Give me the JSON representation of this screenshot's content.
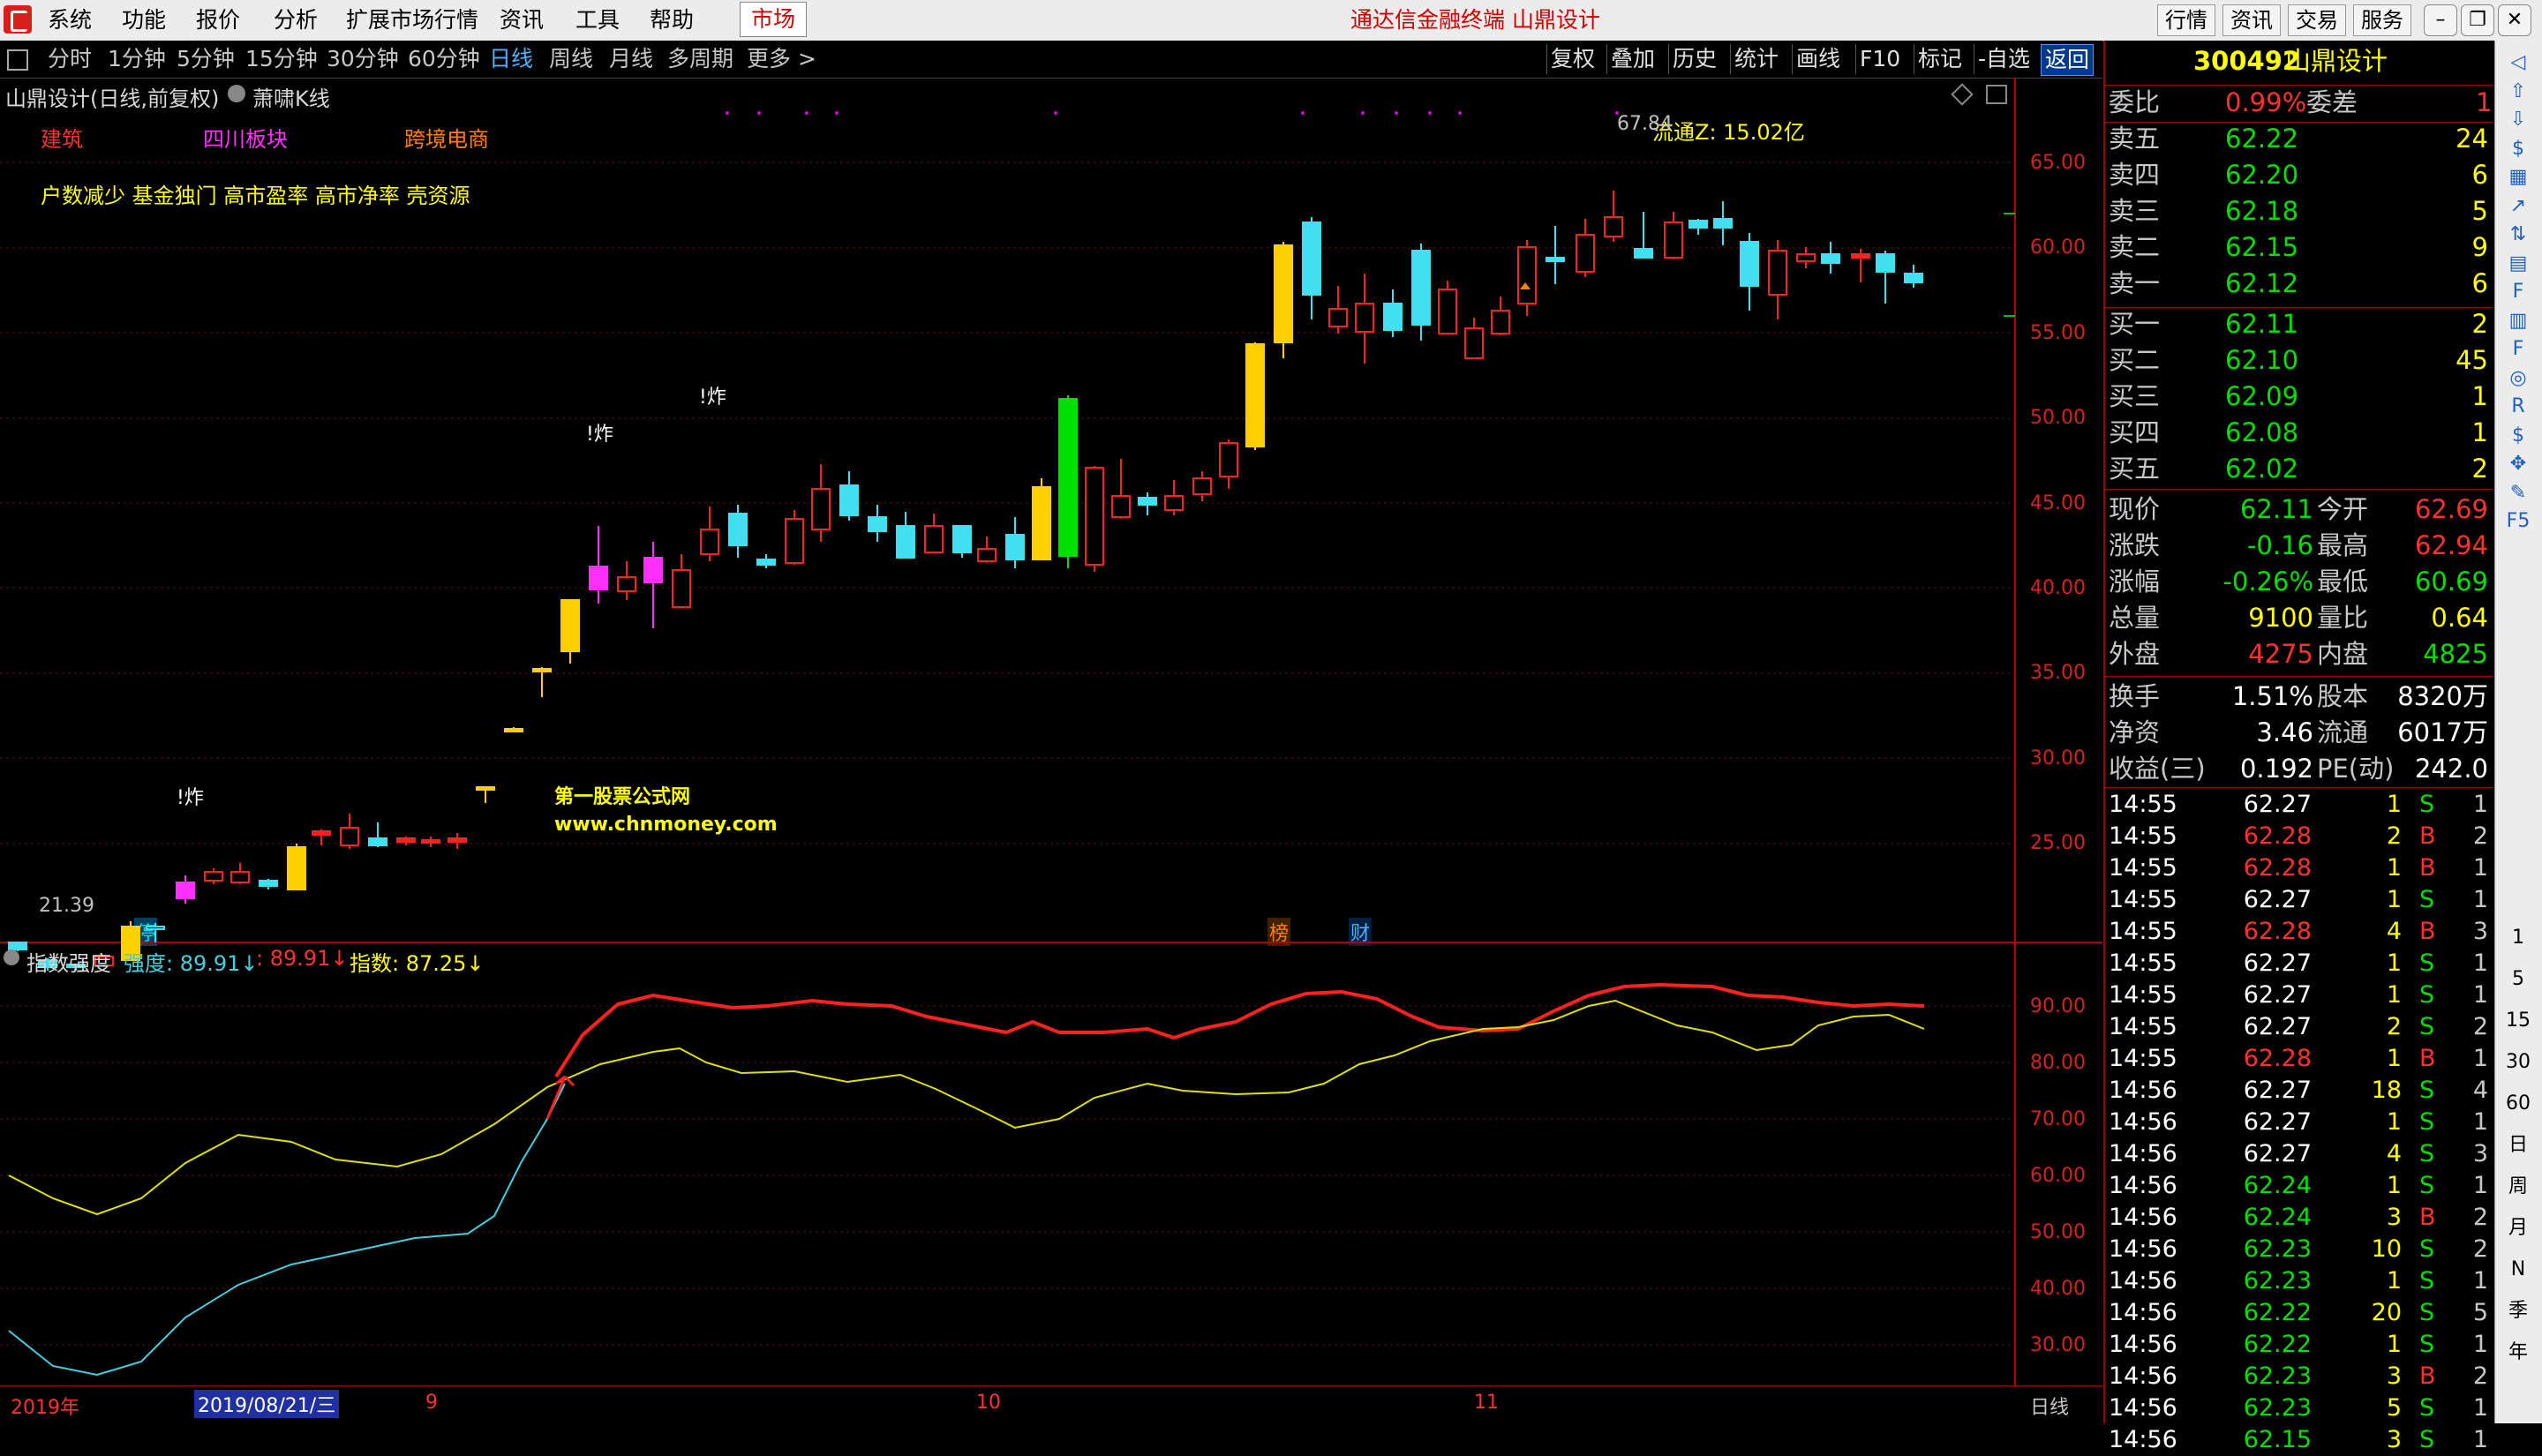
{
  "menu": {
    "items": [
      "系统",
      "功能",
      "报价",
      "分析",
      "扩展市场行情",
      "资讯",
      "工具",
      "帮助"
    ],
    "active": "市场",
    "title": "通达信金融终端  山鼎设计",
    "right_buttons": [
      "行情",
      "资讯",
      "交易",
      "服务"
    ]
  },
  "periods": [
    "分时",
    "1分钟",
    "5分钟",
    "15分钟",
    "30分钟",
    "60分钟",
    "日线",
    "周线",
    "月线",
    "多周期",
    "更多 >"
  ],
  "period_selected": "日线",
  "tools": [
    "复权",
    "叠加",
    "历史",
    "统计",
    "画线",
    "F10",
    "标记",
    "-自选",
    "返回"
  ],
  "chart": {
    "header": "山鼎设计(日线,前复权)",
    "indicator": "萧啸K线",
    "tags": [
      "建筑",
      "四川板块",
      "跨境电商"
    ],
    "features": "户数减少  基金独门  高市盈率  高市净率  壳资源",
    "watermark_name": "第一股票公式网",
    "watermark_url": "www.chnmoney.com",
    "flow_label": "流通Z: 15.02亿",
    "peak_label": "67.84",
    "low_label": "21.39",
    "zha_label": "!炸",
    "ting": "停",
    "bang": "榜",
    "cai": "财",
    "yaxis": [
      "65.00",
      "60.00",
      "55.00",
      "50.00",
      "45.00",
      "40.00",
      "35.00",
      "30.00",
      "25.00"
    ]
  },
  "indicator_pane": {
    "name": "指数强度",
    "strength_label": "强度: 89.91↓",
    "mid_value": ": 89.91↓",
    "index_label": "指数: 87.25↓",
    "yaxis": [
      "90.00",
      "80.00",
      "70.00",
      "60.00",
      "50.00",
      "40.00",
      "30.00"
    ]
  },
  "timeline": {
    "year": "2019年",
    "cursor_date": "2019/08/21/三",
    "months": [
      "9",
      "10",
      "11"
    ],
    "mode": "日线"
  },
  "stock": {
    "code": "300492",
    "name": "山鼎设计"
  },
  "quote": {
    "weibi": {
      "label": "委比",
      "value": "0.99%",
      "label2": "委差",
      "value2": "1"
    },
    "sells": [
      {
        "label": "卖五",
        "price": "62.22",
        "vol": "24"
      },
      {
        "label": "卖四",
        "price": "62.20",
        "vol": "6"
      },
      {
        "label": "卖三",
        "price": "62.18",
        "vol": "5"
      },
      {
        "label": "卖二",
        "price": "62.15",
        "vol": "9"
      },
      {
        "label": "卖一",
        "price": "62.12",
        "vol": "6"
      }
    ],
    "buys": [
      {
        "label": "买一",
        "price": "62.11",
        "vol": "2"
      },
      {
        "label": "买二",
        "price": "62.10",
        "vol": "45"
      },
      {
        "label": "买三",
        "price": "62.09",
        "vol": "1"
      },
      {
        "label": "买四",
        "price": "62.08",
        "vol": "1"
      },
      {
        "label": "买五",
        "price": "62.02",
        "vol": "2"
      }
    ],
    "stats": [
      {
        "l1": "现价",
        "v1": "62.11",
        "l2": "今开",
        "v2": "62.69"
      },
      {
        "l1": "涨跌",
        "v1": "-0.16",
        "l2": "最高",
        "v2": "62.94"
      },
      {
        "l1": "涨幅",
        "v1": "-0.26%",
        "l2": "最低",
        "v2": "60.69"
      },
      {
        "l1": "总量",
        "v1": "9100",
        "l2": "量比",
        "v2": "0.64"
      },
      {
        "l1": "外盘",
        "v1": "4275",
        "l2": "内盘",
        "v2": "4825"
      }
    ],
    "stats2": [
      {
        "l1": "换手",
        "v1": "1.51%",
        "l2": "股本",
        "v2": "8320万"
      },
      {
        "l1": "净资",
        "v1": "3.46",
        "l2": "流通",
        "v2": "6017万"
      },
      {
        "l1": "收益(三)",
        "v1": "0.192",
        "l2": "PE(动)",
        "v2": "242.0"
      }
    ]
  },
  "ticks": [
    [
      "14:55",
      "62.27",
      "1",
      "S",
      "1",
      "w"
    ],
    [
      "14:55",
      "62.28",
      "2",
      "B",
      "2",
      "r"
    ],
    [
      "14:55",
      "62.28",
      "1",
      "B",
      "1",
      "r"
    ],
    [
      "14:55",
      "62.27",
      "1",
      "S",
      "1",
      "w"
    ],
    [
      "14:55",
      "62.28",
      "4",
      "B",
      "3",
      "r"
    ],
    [
      "14:55",
      "62.27",
      "1",
      "S",
      "1",
      "w"
    ],
    [
      "14:55",
      "62.27",
      "1",
      "S",
      "1",
      "w"
    ],
    [
      "14:55",
      "62.27",
      "2",
      "S",
      "2",
      "w"
    ],
    [
      "14:55",
      "62.28",
      "1",
      "B",
      "1",
      "r"
    ],
    [
      "14:56",
      "62.27",
      "18",
      "S",
      "4",
      "w"
    ],
    [
      "14:56",
      "62.27",
      "1",
      "S",
      "1",
      "w"
    ],
    [
      "14:56",
      "62.27",
      "4",
      "S",
      "3",
      "w"
    ],
    [
      "14:56",
      "62.24",
      "1",
      "S",
      "1",
      "g"
    ],
    [
      "14:56",
      "62.24",
      "3",
      "B",
      "2",
      "g"
    ],
    [
      "14:56",
      "62.23",
      "10",
      "S",
      "2",
      "g"
    ],
    [
      "14:56",
      "62.23",
      "1",
      "S",
      "1",
      "g"
    ],
    [
      "14:56",
      "62.22",
      "20",
      "S",
      "5",
      "g"
    ],
    [
      "14:56",
      "62.22",
      "1",
      "S",
      "1",
      "g"
    ],
    [
      "14:56",
      "62.23",
      "3",
      "B",
      "2",
      "g"
    ],
    [
      "14:56",
      "62.23",
      "5",
      "S",
      "1",
      "g"
    ],
    [
      "14:56",
      "62.15",
      "3",
      "S",
      "1",
      "g"
    ]
  ],
  "sidebar_labels": [
    "1",
    "5",
    "15",
    "30",
    "60",
    "日",
    "周",
    "月",
    "N",
    "季",
    "年"
  ]
}
